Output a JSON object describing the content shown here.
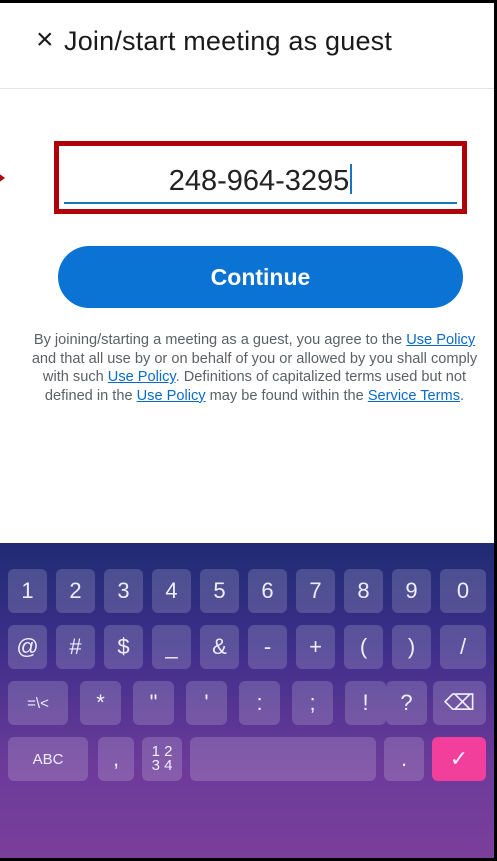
{
  "header": {
    "close_icon": "×",
    "title": "Join/start meeting as guest"
  },
  "input": {
    "value": "248-964-3295"
  },
  "continue_label": "Continue",
  "disclaimer": {
    "p1": "By joining/starting a meeting as a guest, you agree to the ",
    "l1": "Use Policy",
    "p2": " and that all use by or on behalf of you or allowed by you shall comply with such ",
    "l2": "Use Policy",
    "p3": ". Definitions of capitalized terms used but not defined in the ",
    "l3": "Use Policy",
    "p4": " may be found within the ",
    "l4": "Service Terms",
    "p5": "."
  },
  "keyboard": {
    "row1": [
      "1",
      "2",
      "3",
      "4",
      "5",
      "6",
      "7",
      "8",
      "9",
      "0"
    ],
    "row2": [
      "@",
      "#",
      "$",
      "_",
      "&",
      "-",
      "+",
      "(",
      ")",
      "/"
    ],
    "row3": [
      "=\\<",
      "*",
      "\"",
      "'",
      ":",
      ";",
      "!",
      "?",
      "⌫"
    ],
    "row4": [
      "ABC",
      ",",
      "1 2\n3 4",
      " ",
      ".",
      "✓"
    ]
  },
  "colors": {
    "accent": "#0a73d3",
    "highlight": "#b0000a",
    "enter": "#f23f9b"
  }
}
